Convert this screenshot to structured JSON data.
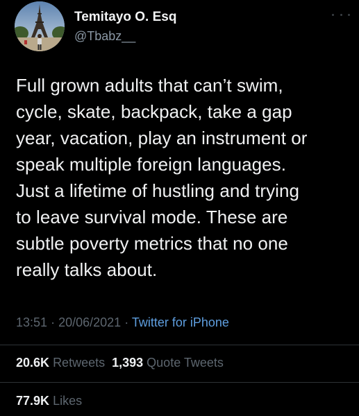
{
  "tweet": {
    "author": {
      "display_name": "Temitayo O. Esq",
      "handle": "@Tbabz__"
    },
    "text_lines": [
      "Full grown adults that can’t swim,",
      "cycle, skate, backpack, take a gap",
      "year, vacation, play an instrument or",
      "speak multiple foreign languages.",
      "Just a lifetime of hustling and trying",
      "to leave survival mode. These are",
      "subtle poverty metrics that no one",
      "really talks about."
    ],
    "time": "13:51",
    "date": "20/06/2021",
    "separator": "·",
    "source": "Twitter for iPhone",
    "stats": {
      "retweets_count": "20.6K",
      "retweets_label": "Retweets",
      "quote_count": "1,393",
      "quote_label": "Quote Tweets",
      "likes_count": "77.9K",
      "likes_label": "Likes"
    }
  },
  "icons": {
    "more": "more-horizontal-icon"
  },
  "colors": {
    "background": "#000000",
    "primary_text": "#f0f1f2",
    "secondary_text": "#5d666f",
    "link": "#5f9fe0",
    "divider": "#2f3336"
  }
}
